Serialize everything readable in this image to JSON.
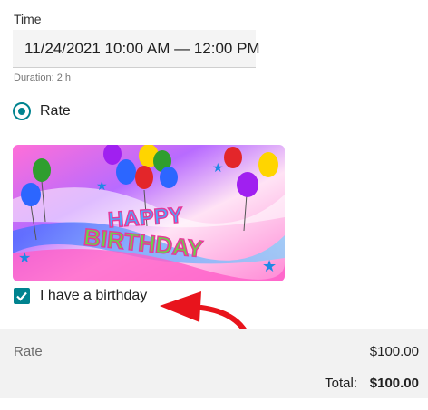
{
  "time": {
    "label": "Time",
    "value": "11/24/2021 10:00 AM — 12:00 PM",
    "duration": "Duration: 2 h"
  },
  "rate_option": {
    "label": "Rate",
    "selected": true
  },
  "banner": {
    "text_line1": "HAPPY",
    "text_line2": "BIRTHDAY"
  },
  "birthday_checkbox": {
    "label": "I have a birthday",
    "checked": true
  },
  "summary": {
    "rate_label": "Rate",
    "rate_value": "$100.00",
    "total_label": "Total:",
    "total_value": "$100.00"
  },
  "colors": {
    "accent": "#00838f",
    "annotation_arrow": "#e8141c"
  },
  "icons": [
    "check-icon",
    "red-arrow-annotation-icon"
  ]
}
